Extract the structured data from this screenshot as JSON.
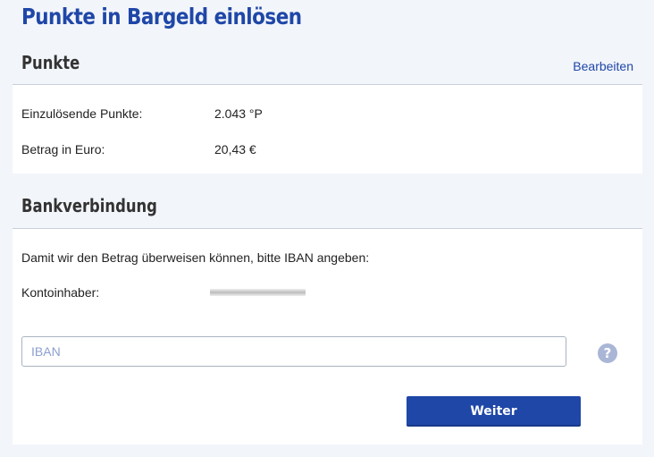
{
  "page": {
    "title": "Punkte in Bargeld einlösen"
  },
  "points_section": {
    "heading": "Punkte",
    "edit_label": "Bearbeiten",
    "rows": [
      {
        "label": "Einzulösende Punkte:",
        "value": "2.043 °P"
      },
      {
        "label": "Betrag in Euro:",
        "value": "20,43 €"
      }
    ]
  },
  "bank_section": {
    "heading": "Bankverbindung",
    "instruction": "Damit wir den Betrag überweisen können, bitte IBAN angeben:",
    "account_holder_label": "Kontoinhaber:",
    "iban_placeholder": "IBAN",
    "iban_value": "",
    "help_icon_glyph": "?",
    "next_label": "Weiter"
  },
  "colors": {
    "accent": "#1f47a8",
    "background": "#f2f5fa",
    "card": "#ffffff",
    "help_icon": "#aab6d6"
  }
}
